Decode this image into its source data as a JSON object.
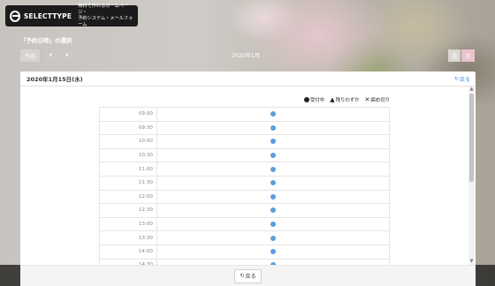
{
  "brand": {
    "name": "SELECTTYPE",
    "tagline_line1": "無料で作れるホームページ・",
    "tagline_line2": "予約システム・メールフォーム"
  },
  "header": {
    "section_title": "「予約日時」の選択",
    "today_label": "今月",
    "prev_label": "‹",
    "next_label": "›",
    "month_label": "2020年1月",
    "view_week_label": "週",
    "view_month_label": "月"
  },
  "panel": {
    "date_label": "2020年1月15日(水)",
    "back_label": "戻る"
  },
  "legend": {
    "available": "受付中",
    "few_left": "残りわずか",
    "closed": "締め切り"
  },
  "slots": [
    {
      "time": "09:00",
      "status": "available"
    },
    {
      "time": "09:30",
      "status": "available"
    },
    {
      "time": "10:00",
      "status": "available"
    },
    {
      "time": "10:30",
      "status": "available"
    },
    {
      "time": "11:00",
      "status": "available"
    },
    {
      "time": "11:30",
      "status": "available"
    },
    {
      "time": "12:00",
      "status": "available"
    },
    {
      "time": "12:30",
      "status": "available"
    },
    {
      "time": "13:00",
      "status": "available"
    },
    {
      "time": "13:30",
      "status": "available"
    },
    {
      "time": "14:00",
      "status": "available"
    },
    {
      "time": "14:30",
      "status": "available"
    }
  ],
  "footer": {
    "back_label": "戻る"
  },
  "colors": {
    "accent": "#5b9fdb",
    "link": "#3a8bd6",
    "active_view": "#e9c4cc"
  }
}
